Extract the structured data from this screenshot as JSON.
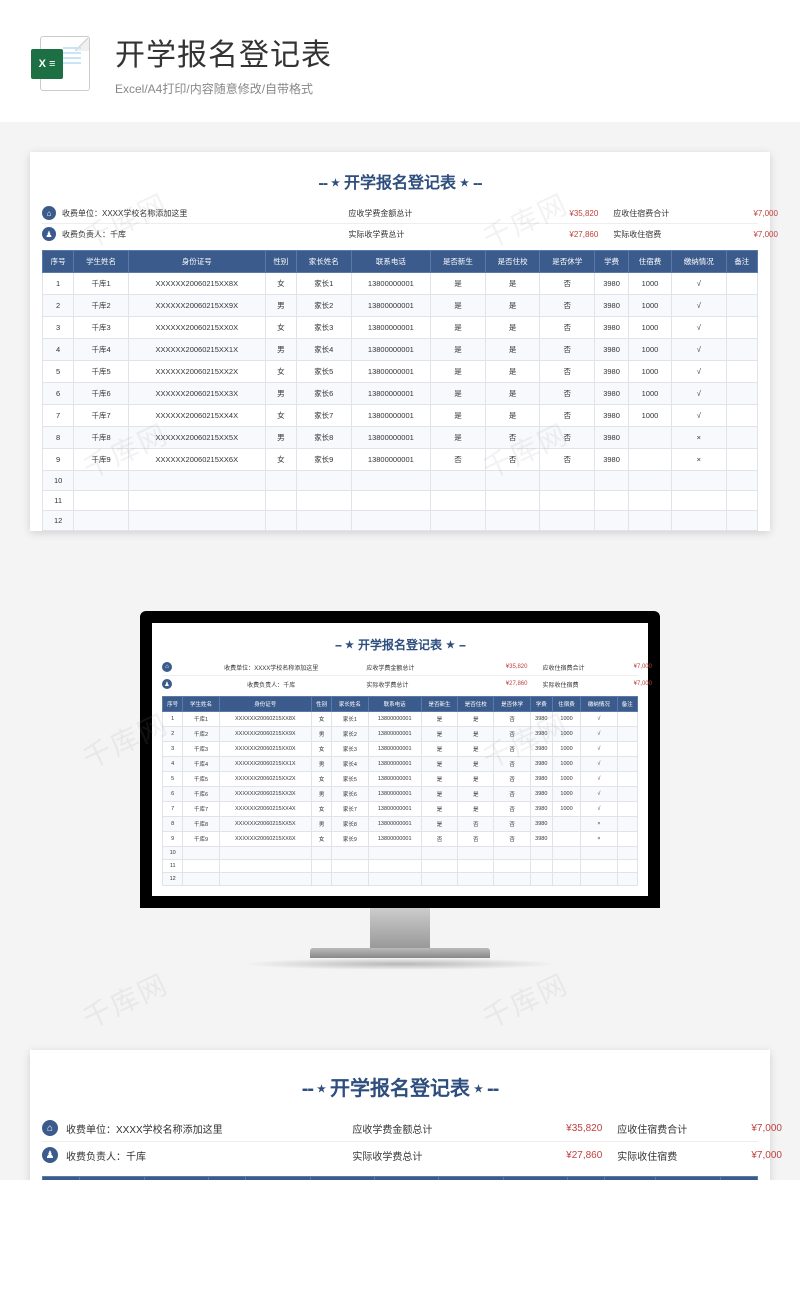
{
  "header": {
    "main_title": "开学报名登记表",
    "sub_title": "Excel/A4打印/内容随意修改/自带格式",
    "excel_badge": "X ≡"
  },
  "doc": {
    "title": "开学报名登记表",
    "org_label": "收费单位：",
    "org_value": "XXXX学校名称添加这里",
    "person_label": "收费负责人：",
    "person_value": "千库",
    "fee_due_label": "应收学费金额总计",
    "fee_due_value": "¥35,820",
    "dorm_due_label": "应收住宿费合计",
    "dorm_due_value": "¥7,000",
    "fee_actual_label": "实际收学费总计",
    "fee_actual_value": "¥27,860",
    "dorm_actual_label": "实际收住宿费",
    "dorm_actual_value": "¥7,000"
  },
  "columns": [
    "序号",
    "学生姓名",
    "身份证号",
    "性别",
    "家长姓名",
    "联系电话",
    "是否新生",
    "是否住校",
    "是否休学",
    "学费",
    "住宿费",
    "缴纳情况",
    "备注"
  ],
  "rows": [
    {
      "no": "1",
      "name": "千库1",
      "id": "XXXXXX20060215XX8X",
      "sex": "女",
      "parent": "家长1",
      "phone": "13800000001",
      "new": "是",
      "dorm": "是",
      "leave": "否",
      "fee": "3980",
      "dormfee": "1000",
      "paid": "√",
      "note": ""
    },
    {
      "no": "2",
      "name": "千库2",
      "id": "XXXXXX20060215XX9X",
      "sex": "男",
      "parent": "家长2",
      "phone": "13800000001",
      "new": "是",
      "dorm": "是",
      "leave": "否",
      "fee": "3980",
      "dormfee": "1000",
      "paid": "√",
      "note": ""
    },
    {
      "no": "3",
      "name": "千库3",
      "id": "XXXXXX20060215XX0X",
      "sex": "女",
      "parent": "家长3",
      "phone": "13800000001",
      "new": "是",
      "dorm": "是",
      "leave": "否",
      "fee": "3980",
      "dormfee": "1000",
      "paid": "√",
      "note": ""
    },
    {
      "no": "4",
      "name": "千库4",
      "id": "XXXXXX20060215XX1X",
      "sex": "男",
      "parent": "家长4",
      "phone": "13800000001",
      "new": "是",
      "dorm": "是",
      "leave": "否",
      "fee": "3980",
      "dormfee": "1000",
      "paid": "√",
      "note": ""
    },
    {
      "no": "5",
      "name": "千库5",
      "id": "XXXXXX20060215XX2X",
      "sex": "女",
      "parent": "家长5",
      "phone": "13800000001",
      "new": "是",
      "dorm": "是",
      "leave": "否",
      "fee": "3980",
      "dormfee": "1000",
      "paid": "√",
      "note": ""
    },
    {
      "no": "6",
      "name": "千库6",
      "id": "XXXXXX20060215XX3X",
      "sex": "男",
      "parent": "家长6",
      "phone": "13800000001",
      "new": "是",
      "dorm": "是",
      "leave": "否",
      "fee": "3980",
      "dormfee": "1000",
      "paid": "√",
      "note": ""
    },
    {
      "no": "7",
      "name": "千库7",
      "id": "XXXXXX20060215XX4X",
      "sex": "女",
      "parent": "家长7",
      "phone": "13800000001",
      "new": "是",
      "dorm": "是",
      "leave": "否",
      "fee": "3980",
      "dormfee": "1000",
      "paid": "√",
      "note": ""
    },
    {
      "no": "8",
      "name": "千库8",
      "id": "XXXXXX20060215XX5X",
      "sex": "男",
      "parent": "家长8",
      "phone": "13800000001",
      "new": "是",
      "dorm": "否",
      "leave": "否",
      "fee": "3980",
      "dormfee": "",
      "paid": "×",
      "note": ""
    },
    {
      "no": "9",
      "name": "千库9",
      "id": "XXXXXX20060215XX6X",
      "sex": "女",
      "parent": "家长9",
      "phone": "13800000001",
      "new": "否",
      "dorm": "否",
      "leave": "否",
      "fee": "3980",
      "dormfee": "",
      "paid": "×",
      "note": ""
    },
    {
      "no": "10",
      "name": "",
      "id": "",
      "sex": "",
      "parent": "",
      "phone": "",
      "new": "",
      "dorm": "",
      "leave": "",
      "fee": "",
      "dormfee": "",
      "paid": "",
      "note": ""
    },
    {
      "no": "11",
      "name": "",
      "id": "",
      "sex": "",
      "parent": "",
      "phone": "",
      "new": "",
      "dorm": "",
      "leave": "",
      "fee": "",
      "dormfee": "",
      "paid": "",
      "note": ""
    },
    {
      "no": "12",
      "name": "",
      "id": "",
      "sex": "",
      "parent": "",
      "phone": "",
      "new": "",
      "dorm": "",
      "leave": "",
      "fee": "",
      "dormfee": "",
      "paid": "",
      "note": ""
    }
  ],
  "watermark": "千库网"
}
